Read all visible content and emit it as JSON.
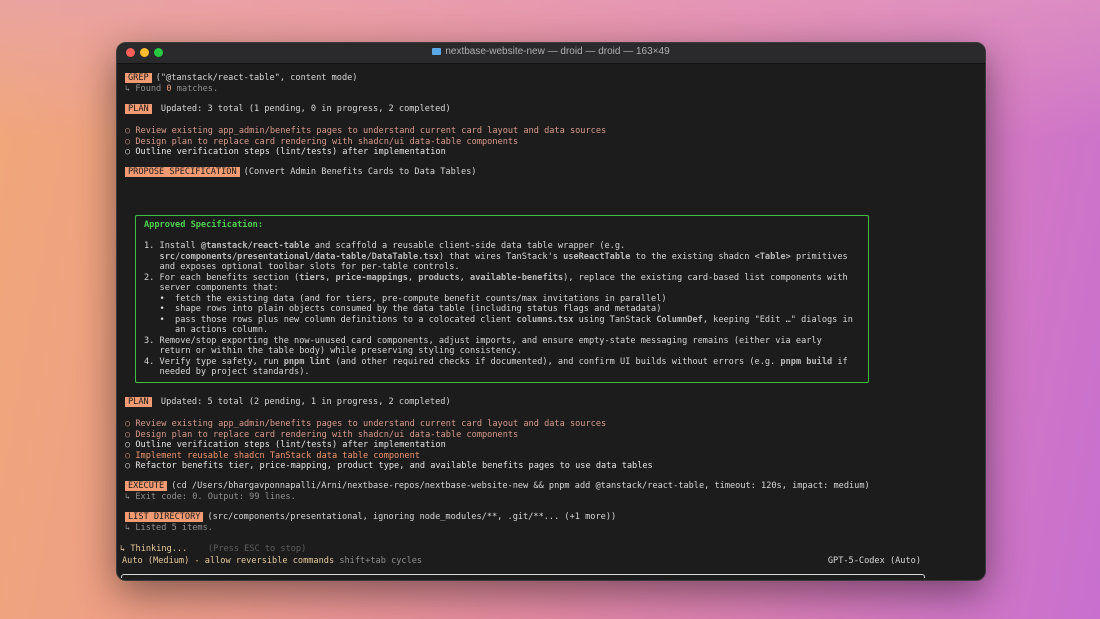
{
  "window": {
    "title": "nextbase-website-new — droid — droid — 163×49"
  },
  "log": {
    "grep": {
      "tag": "GREP",
      "args": "(\"@tanstack/react-table\", content mode)",
      "result_pre": "↳ Found ",
      "result_num": "0",
      "result_post": " matches."
    },
    "plan1": {
      "tag": "PLAN",
      "summary": "Updated: 3 total (1 pending, 0 in progress, 2 completed)",
      "items": [
        "○ Review existing app_admin/benefits pages to understand current card layout and data sources",
        "○ Design plan to replace card rendering with shadcn/ui data-table components",
        "○ Outline verification steps (lint/tests) after implementation"
      ]
    },
    "propose": {
      "tag": "PROPOSE SPECIFICATION",
      "args": "(Convert Admin Benefits Cards to Data Tables)"
    },
    "spec": {
      "title": "Approved Specification:",
      "lines": {
        "l1a": "1. Install ",
        "l1b": "@tanstack/react-table",
        "l1c": " and scaffold a reusable client-side data table wrapper (e.g.",
        "l2a": "   ",
        "l2b": "src/components/presentational/data-table/DataTable.tsx",
        "l2c": ") that wires TanStack's ",
        "l2d": "useReactTable",
        "l2e": " to the existing shadcn ",
        "l2f": "<Table>",
        "l2g": " primitives",
        "l3": "   and exposes optional toolbar slots for per-table controls.",
        "l4a": "2. For each benefits section (",
        "l4b": "tiers",
        "l4c": ", ",
        "l4d": "price-mappings",
        "l4e": ", ",
        "l4f": "products",
        "l4g": ", ",
        "l4h": "available-benefits",
        "l4i": "), replace the existing card-based list components with",
        "l5": "   server components that:",
        "l6": "   •  fetch the existing data (and for tiers, pre-compute benefit counts/max invitations in parallel)",
        "l7": "   •  shape rows into plain objects consumed by the data table (including status flags and metadata)",
        "l8a": "   •  pass those rows plus new column definitions to a colocated client ",
        "l8b": "columns.tsx",
        "l8c": " using TanStack ",
        "l8d": "ColumnDef",
        "l8e": ", keeping \"Edit …\" dialogs in",
        "l9": "      an actions column.",
        "l10": "3. Remove/stop exporting the now-unused card components, adjust imports, and ensure empty-state messaging remains (either via early",
        "l11": "   return or within the table body) while preserving styling consistency.",
        "l12a": "4. Verify type safety, run ",
        "l12b": "pnpm lint",
        "l12c": " (and other required checks if documented), and confirm UI builds without errors (e.g. ",
        "l12d": "pnpm build",
        "l12e": " if",
        "l13": "   needed by project standards)."
      }
    },
    "plan2": {
      "tag": "PLAN",
      "summary": "Updated: 5 total (2 pending, 1 in progress, 2 completed)",
      "items": [
        "○ Review existing app_admin/benefits pages to understand current card layout and data sources",
        "○ Design plan to replace card rendering with shadcn/ui data-table components",
        "○ Outline verification steps (lint/tests) after implementation",
        "○ Implement reusable shadcn TanStack data table component",
        "○ Refactor benefits tier, price-mapping, product type, and available benefits pages to use data tables"
      ]
    },
    "execute": {
      "tag": "EXECUTE",
      "args": "(cd /Users/bhargavponnapalli/Arni/nextbase-repos/nextbase-website-new && pnpm add @tanstack/react-table, timeout: 120s, impact: medium)",
      "result": "↳ Exit code: 0. Output: 99 lines."
    },
    "listdir": {
      "tag": "LIST DIRECTORY",
      "args": "(src/components/presentational, ignoring node_modules/**, .git/**... (+1 more))",
      "result": "↳ Listed 5 items."
    },
    "thinking": {
      "text": "↳ Thinking...",
      "hint": "(Press ESC to stop)"
    }
  },
  "status": {
    "mode": "Auto (Medium) - allow reversible commands",
    "hint": "shift+tab cycles",
    "model": "GPT-5-Codex (Auto)"
  }
}
